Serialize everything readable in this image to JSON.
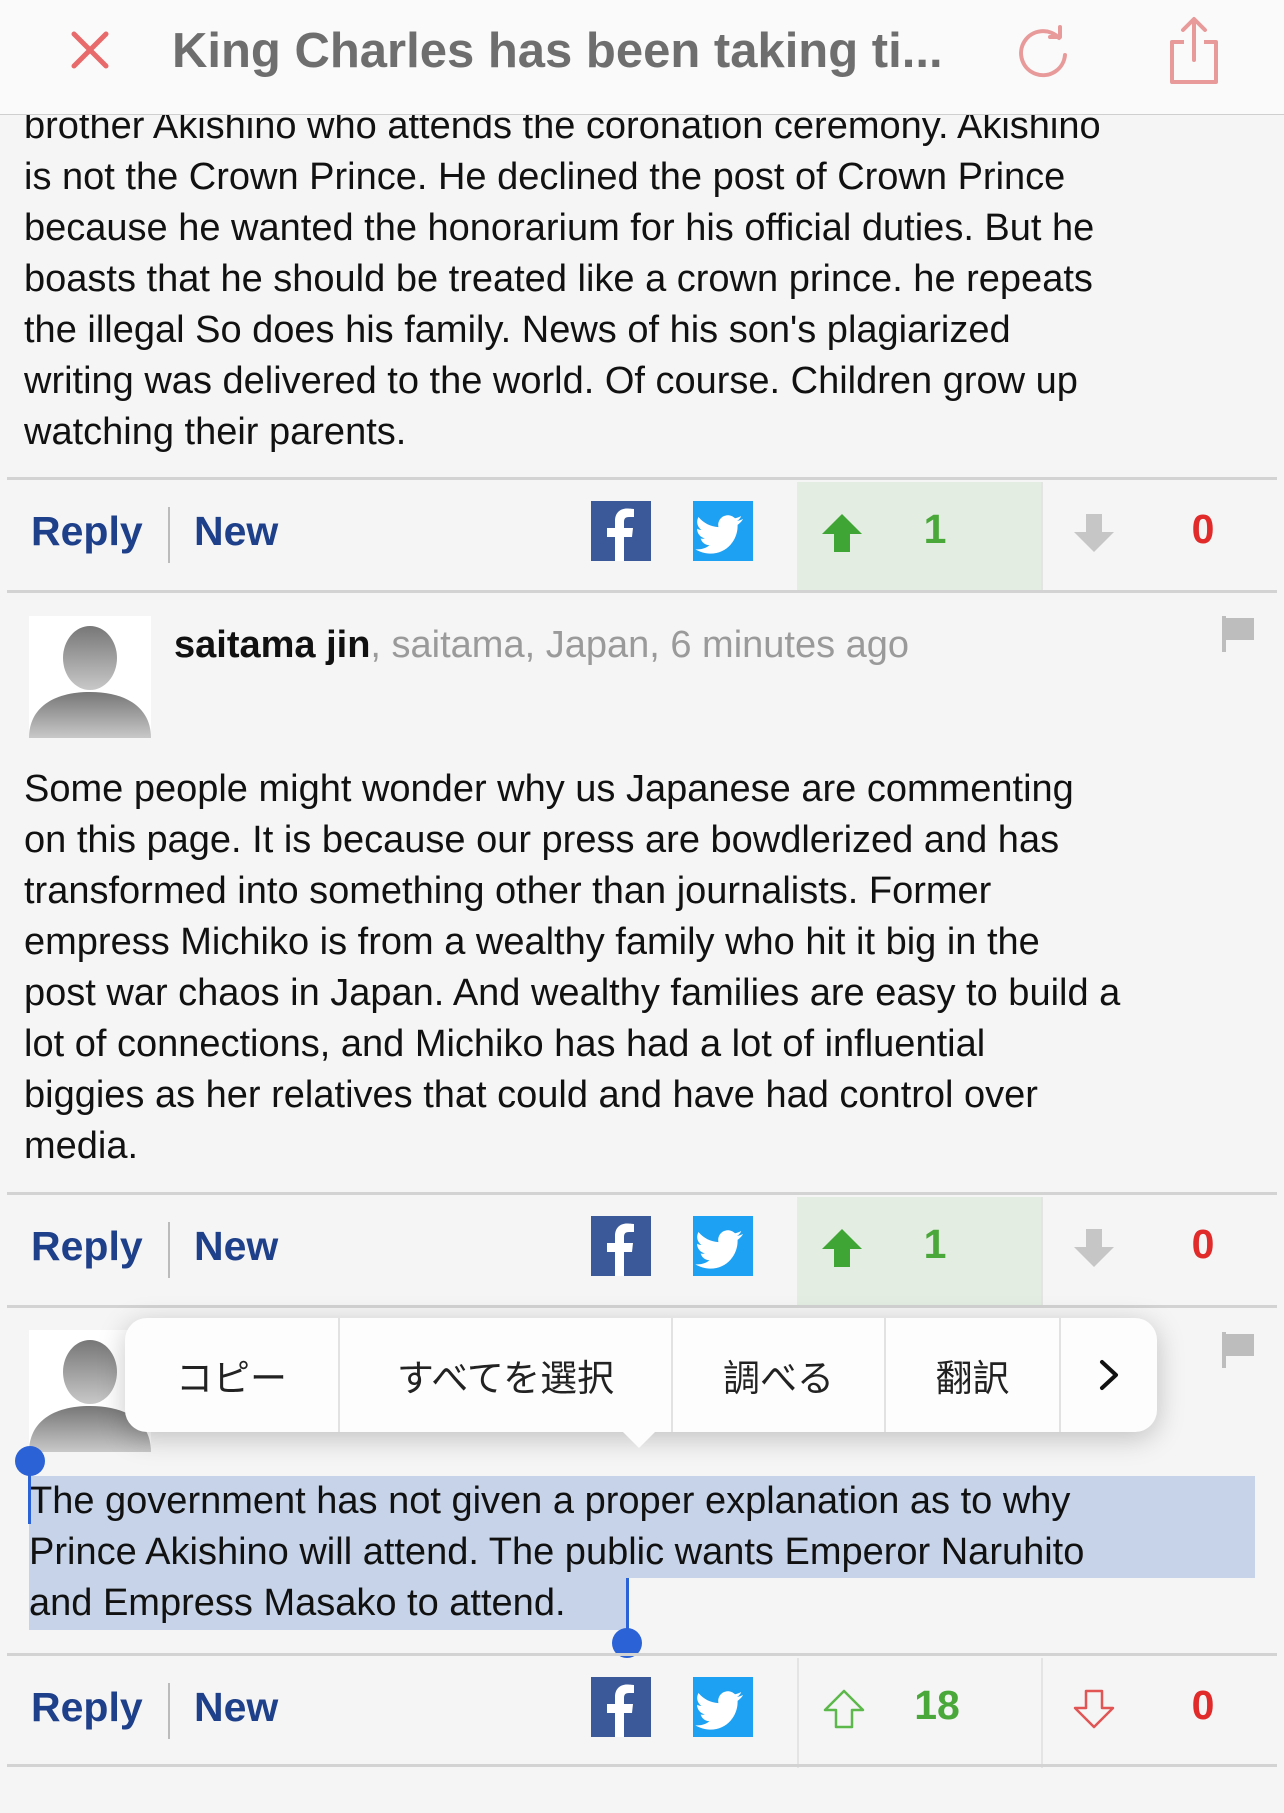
{
  "header": {
    "title": "King Charles has been taking ti..."
  },
  "comments": [
    {
      "text_lines": [
        "brother Akishino who attends the coronation ceremony. Akishino",
        "is not the Crown Prince. He declined the post of Crown Prince",
        "because he wanted the honorarium for his official duties. But he",
        "boasts that he should be treated like a crown prince. he repeats",
        "the illegal So does his family. News of his son's plagiarized",
        "writing was delivered to the world. Of course. Children grow up",
        "watching their parents."
      ],
      "actions": {
        "reply": "Reply",
        "new": "New",
        "up_count": "1",
        "down_count": "0",
        "upvoted": true
      }
    },
    {
      "author": "saitama jin",
      "meta": ", saitama, Japan, 6 minutes ago",
      "text_lines": [
        "Some people might wonder why us Japanese are commenting",
        "on this page. It is because our press are bowdlerized and has",
        "transformed into something other than journalists. Former",
        "empress Michiko is from a wealthy family who hit it big in the",
        "post war chaos in Japan. And wealthy families are easy to build a",
        "lot of connections, and Michiko has had a lot of influential",
        "biggies as her relatives that could and have had control over",
        "media."
      ],
      "actions": {
        "reply": "Reply",
        "new": "New",
        "up_count": "1",
        "down_count": "0",
        "upvoted": true
      }
    },
    {
      "text_lines": [
        "The government has not given a proper explanation as to why",
        "Prince Akishino will attend. The public wants Emperor Naruhito",
        "and Empress Masako to attend."
      ],
      "actions": {
        "reply": "Reply",
        "new": "New",
        "up_count": "18",
        "down_count": "0",
        "upvoted": false
      }
    }
  ],
  "context_menu": {
    "items": [
      "コピー",
      "すべてを選択",
      "調べる",
      "翻訳"
    ],
    "more_icon": "chevron-right-icon"
  },
  "colors": {
    "link_blue": "#1e3f8a",
    "up_green": "#4aa83a",
    "down_red": "#e12a2a",
    "close_red": "#e86a6a",
    "selection": "#c6d3e8",
    "handle_blue": "#2b62d6",
    "facebook": "#3b5998",
    "twitter": "#1da1f2"
  },
  "icons": {
    "close": "close-icon",
    "reload": "reload-icon",
    "share": "share-icon",
    "facebook": "facebook-icon",
    "twitter": "twitter-icon",
    "upvote": "thumbs-up-arrow-icon",
    "downvote": "thumbs-down-arrow-icon",
    "flag": "flag-icon",
    "avatar": "avatar-silhouette-icon"
  }
}
